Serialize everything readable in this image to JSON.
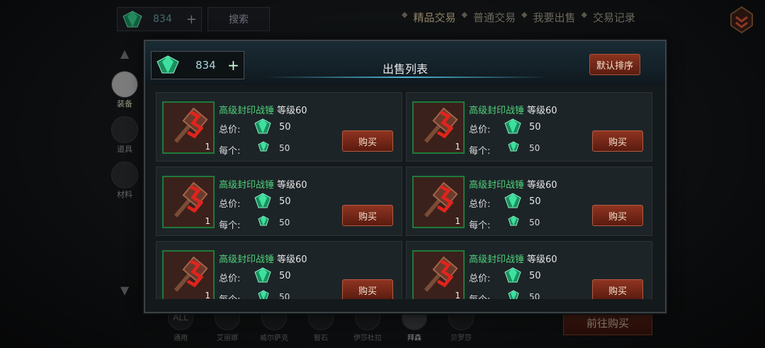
{
  "topbar": {
    "gem_count": "834",
    "plus": "+",
    "search_label": "搜索",
    "tabs": [
      "精品交易",
      "普通交易",
      "我要出售",
      "交易记录"
    ],
    "active_tab": 0
  },
  "leftnav": {
    "items": [
      {
        "label": "装备",
        "icon": "armor-icon"
      },
      {
        "label": "道具",
        "icon": "potion-icon"
      },
      {
        "label": "材料",
        "icon": "pouch-icon"
      }
    ]
  },
  "bottombar": {
    "items": [
      "通用",
      "艾丽娜",
      "威尔萨克",
      "智石",
      "伊莎杜拉",
      "拜森",
      "贝罗莎"
    ],
    "all_label": "ALL",
    "goto_buy_label": "前往购买"
  },
  "modal": {
    "title": "出售列表",
    "gem_count": "834",
    "plus": "+",
    "sort_label": "默认排序",
    "total_label": "总价:",
    "each_label": "每个:",
    "buy_label": "购买",
    "items": [
      {
        "name": "高级封印战锤",
        "level": "等级60",
        "total": "50",
        "each": "50",
        "qty": "1"
      },
      {
        "name": "高级封印战锤",
        "level": "等级60",
        "total": "50",
        "each": "50",
        "qty": "1"
      },
      {
        "name": "高级封印战锤",
        "level": "等级60",
        "total": "50",
        "each": "50",
        "qty": "1"
      },
      {
        "name": "高级封印战锤",
        "level": "等级60",
        "total": "50",
        "each": "50",
        "qty": "1"
      },
      {
        "name": "高级封印战锤",
        "level": "等级60",
        "total": "50",
        "each": "50",
        "qty": "1"
      },
      {
        "name": "高级封印战锤",
        "level": "等级60",
        "total": "50",
        "each": "50",
        "qty": "1"
      }
    ]
  },
  "colors": {
    "item_name": "#4fd17a",
    "button": "#8f3421",
    "gem": "#2fd38a"
  }
}
